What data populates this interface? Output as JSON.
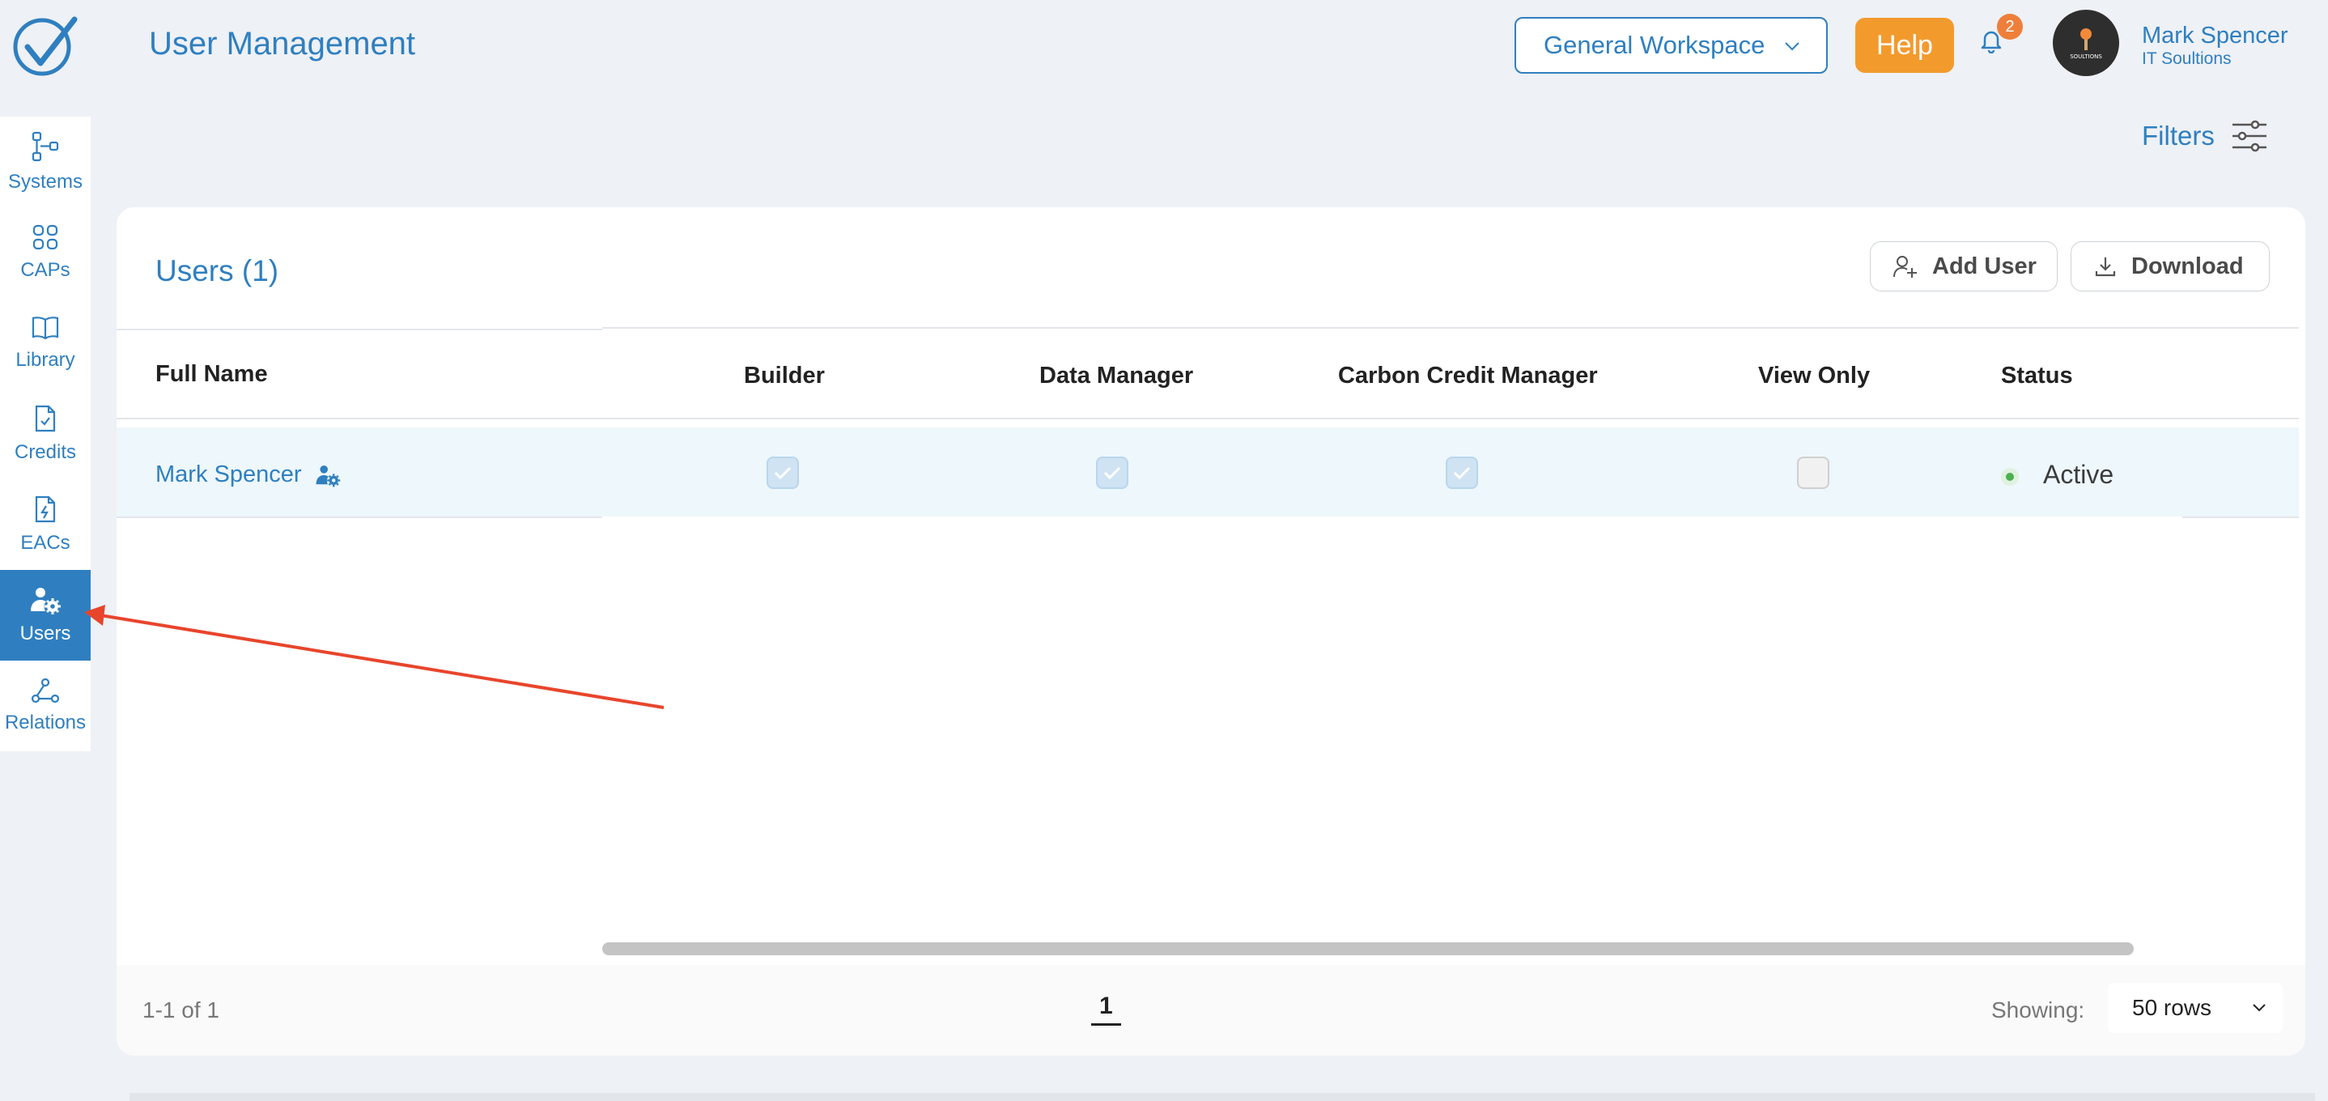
{
  "header": {
    "title": "User Management",
    "workspace": "General Workspace",
    "help_label": "Help",
    "notification_count": "2",
    "user_name": "Mark Spencer",
    "user_org": "IT Soultions",
    "avatar_text": "SOULTIONS"
  },
  "sidebar": {
    "items": [
      {
        "label": "Systems",
        "icon": "systems-icon"
      },
      {
        "label": "CAPs",
        "icon": "grid-icon"
      },
      {
        "label": "Library",
        "icon": "book-icon"
      },
      {
        "label": "Credits",
        "icon": "document-check-icon"
      },
      {
        "label": "EACs",
        "icon": "document-bolt-icon"
      },
      {
        "label": "Users",
        "icon": "user-gear-icon",
        "active": true
      },
      {
        "label": "Relations",
        "icon": "relations-icon"
      }
    ]
  },
  "filters_label": "Filters",
  "users_card": {
    "title": "Users (1)",
    "add_user_label": "Add User",
    "download_label": "Download",
    "columns": [
      "Full Name",
      "Builder",
      "Data Manager",
      "Carbon Credit Manager",
      "View Only",
      "Status"
    ],
    "rows": [
      {
        "full_name": "Mark Spencer",
        "builder": true,
        "data_manager": true,
        "carbon_credit_manager": true,
        "view_only": false,
        "status": "Active"
      }
    ]
  },
  "pagination": {
    "range": "1-1 of 1",
    "current_page": "1",
    "showing_label": "Showing:",
    "rows_option": "50 rows"
  },
  "colors": {
    "accent": "#2f7fc0",
    "help_button": "#f39a2d",
    "badge": "#ee7f3b",
    "annotation_arrow": "#e8452c",
    "status_active": "#4caf50"
  }
}
